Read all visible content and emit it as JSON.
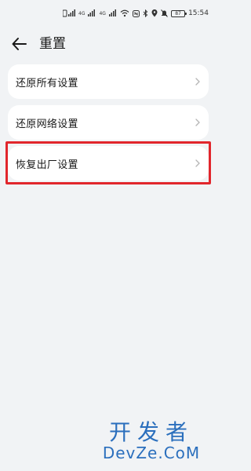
{
  "status_bar": {
    "sim1": "4G",
    "sim2": "4G",
    "battery": "87",
    "time": "15:54"
  },
  "header": {
    "title": "重置"
  },
  "options": [
    {
      "label": "还原所有设置"
    },
    {
      "label": "还原网络设置"
    },
    {
      "label": "恢复出厂设置"
    }
  ],
  "watermark": {
    "line1": "开发者",
    "line2": "DevZe.CoM"
  },
  "colors": {
    "background": "#f1f3f5",
    "card": "#ffffff",
    "highlight": "#e1262c",
    "watermark": "#2b6fbd"
  }
}
